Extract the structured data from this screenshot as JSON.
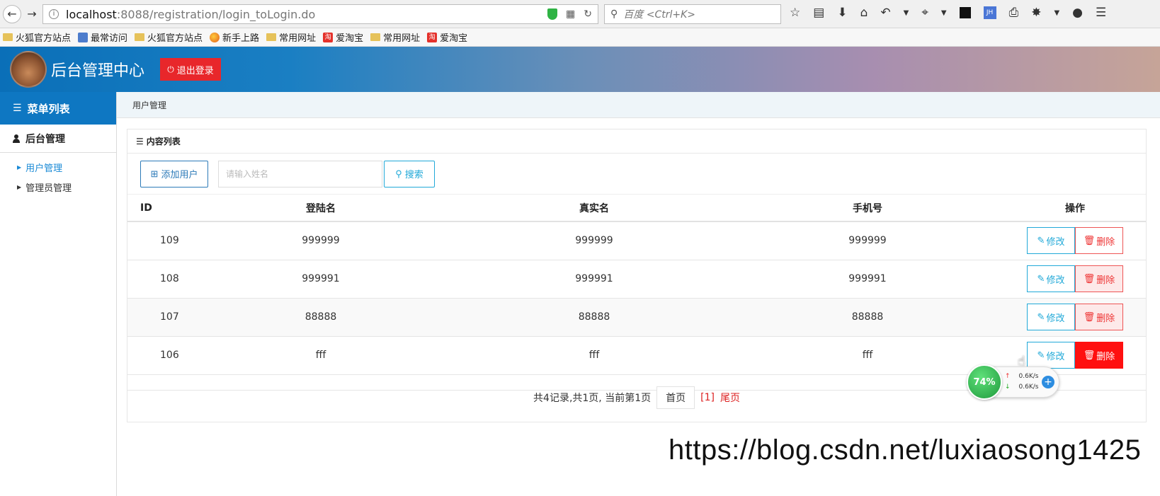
{
  "browser": {
    "url_host": "localhost",
    "url_path": ":8088/registration/login_toLogin.do",
    "search_placeholder": "百度 <Ctrl+K>"
  },
  "bookmarks": [
    {
      "label": "火狐官方站点",
      "icon": "folder-icon"
    },
    {
      "label": "最常访问",
      "icon": "star-page-icon"
    },
    {
      "label": "火狐官方站点",
      "icon": "folder-icon"
    },
    {
      "label": "新手上路",
      "icon": "firefox-icon"
    },
    {
      "label": "常用网址",
      "icon": "folder-icon"
    },
    {
      "label": "爱淘宝",
      "icon": "taobao-icon"
    },
    {
      "label": "常用网址",
      "icon": "folder-icon"
    },
    {
      "label": "爱淘宝",
      "icon": "taobao-icon"
    }
  ],
  "header": {
    "title": "后台管理中心",
    "logout_label": "退出登录"
  },
  "sidebar": {
    "menu_title": "菜单列表",
    "group_label": "后台管理",
    "items": [
      {
        "label": "用户管理",
        "active": true
      },
      {
        "label": "管理员管理",
        "active": false
      }
    ]
  },
  "main": {
    "breadcrumb": "用户管理",
    "panel_title": "内容列表",
    "add_label": "添加用户",
    "search_placeholder": "请输入姓名",
    "search_label": "搜索"
  },
  "table": {
    "headers": [
      "ID",
      "登陆名",
      "真实名",
      "手机号",
      "操作"
    ],
    "rows": [
      {
        "id": "109",
        "login": "999999",
        "real": "999999",
        "phone": "999999"
      },
      {
        "id": "108",
        "login": "999991",
        "real": "999991",
        "phone": "999991"
      },
      {
        "id": "107",
        "login": "88888",
        "real": "88888",
        "phone": "88888"
      },
      {
        "id": "106",
        "login": "fff",
        "real": "fff",
        "phone": "fff"
      }
    ],
    "edit_label": "修改",
    "delete_label": "删除"
  },
  "pager": {
    "summary": "共4记录,共1页, 当前第1页",
    "first_label": "首页",
    "current_label": "[1]",
    "last_label": "尾页"
  },
  "net_widget": {
    "percent": "74%",
    "up_rate": "0.6K/s",
    "down_rate": "0.6K/s"
  },
  "watermark": "https://blog.csdn.net/luxiaosong1425",
  "colors": {
    "primary_blue": "#0e77c2",
    "danger_red": "#e8272b",
    "info_cyan": "#21a9d8"
  }
}
